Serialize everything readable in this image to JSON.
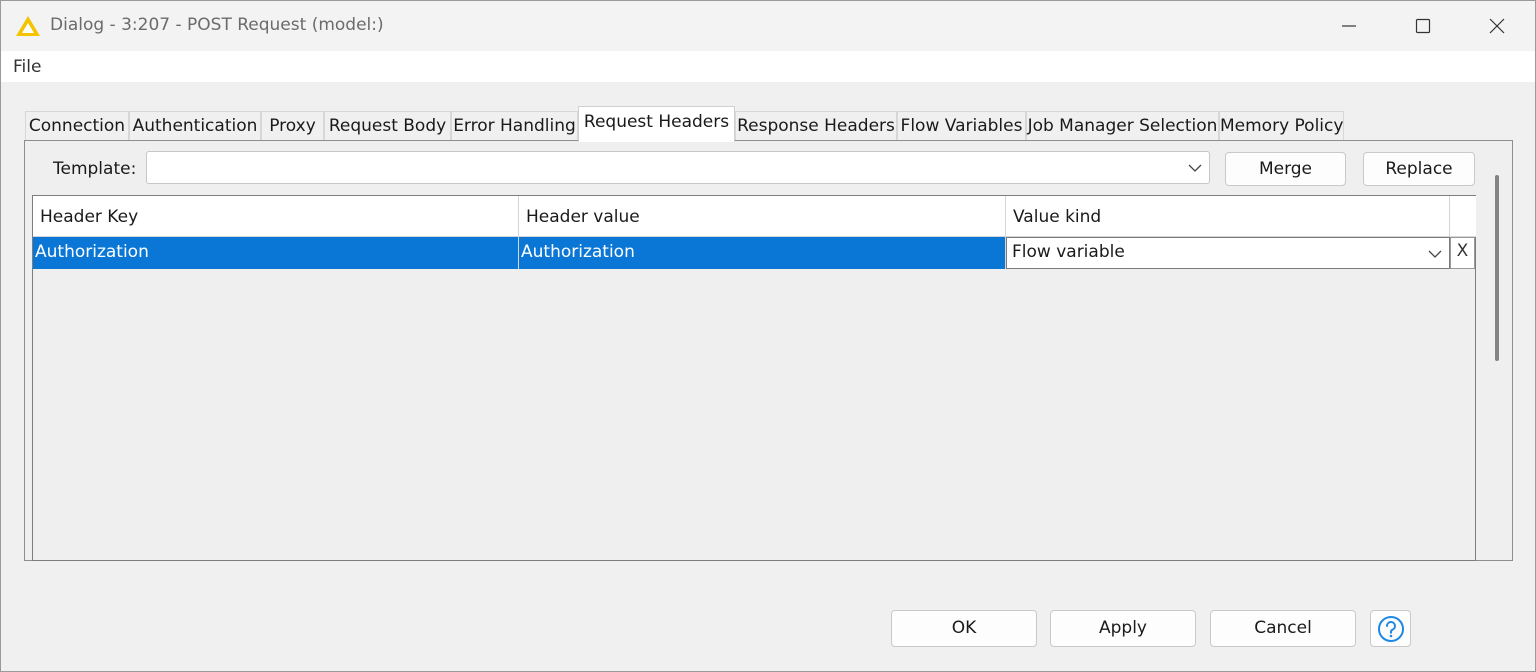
{
  "window": {
    "title": "Dialog - 3:207 - POST Request (model:)",
    "icon": "warning-triangle-icon",
    "accent_color": "#f5c400"
  },
  "menu": {
    "file": "File"
  },
  "tabs": [
    {
      "label": "Connection"
    },
    {
      "label": "Authentication"
    },
    {
      "label": "Proxy"
    },
    {
      "label": "Request Body"
    },
    {
      "label": "Error Handling"
    },
    {
      "label": "Request Headers",
      "active": true
    },
    {
      "label": "Response Headers"
    },
    {
      "label": "Flow Variables"
    },
    {
      "label": "Job Manager Selection"
    },
    {
      "label": "Memory Policy"
    }
  ],
  "template": {
    "label": "Template:",
    "value": "",
    "merge_label": "Merge",
    "replace_label": "Replace"
  },
  "table": {
    "columns": [
      "Header Key",
      "Header value",
      "Value kind"
    ],
    "rows": [
      {
        "key": "Authorization",
        "value": "Authorization",
        "kind": "Flow variable",
        "remove": "X"
      }
    ],
    "selection_color": "#0a77d6"
  },
  "footer": {
    "ok_label": "OK",
    "apply_label": "Apply",
    "cancel_label": "Cancel",
    "help_icon": "help-question-icon",
    "help_color": "#1e88e5"
  }
}
